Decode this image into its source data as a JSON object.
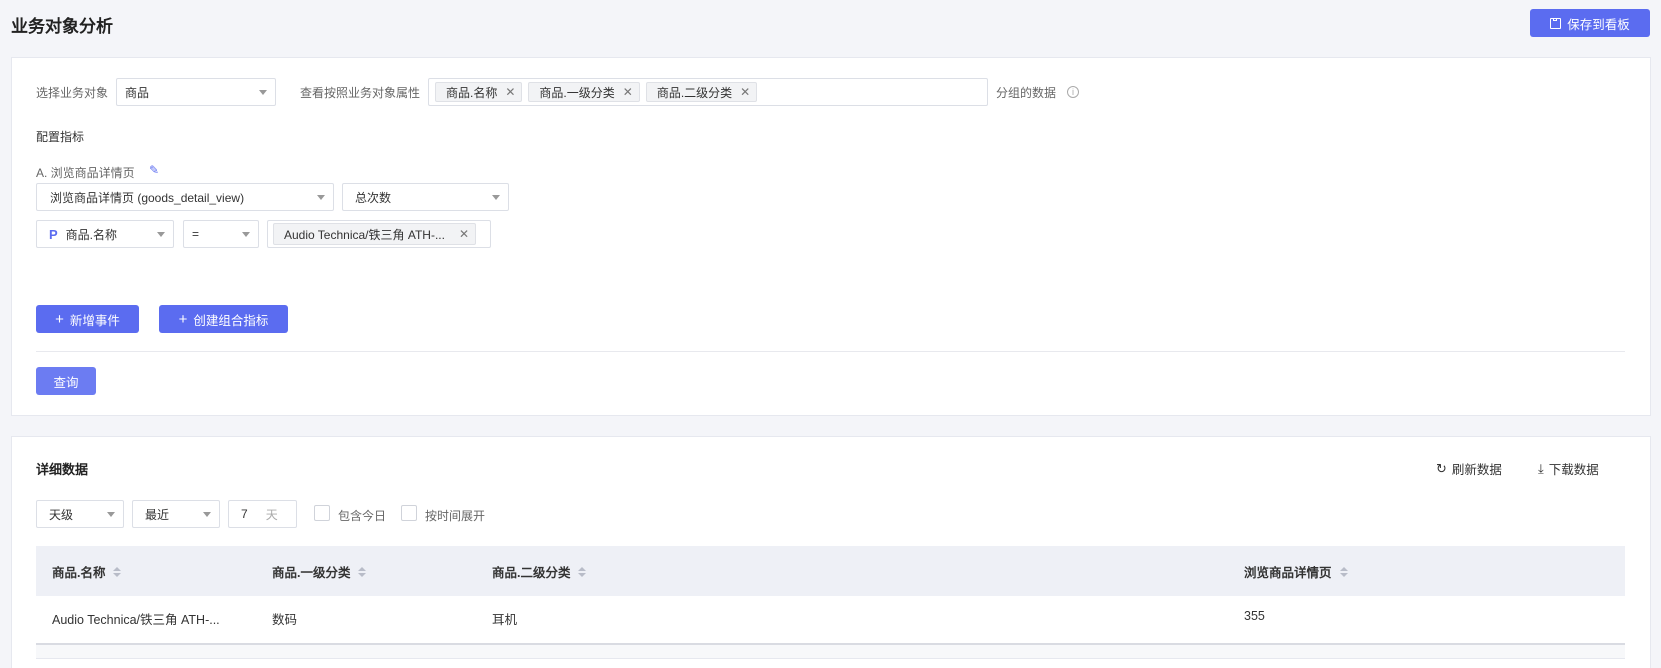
{
  "header": {
    "title": "业务对象分析",
    "save_label": "保存到看板"
  },
  "config": {
    "object_label": "选择业务对象",
    "object_value": "商品",
    "group_by_label": "查看按照业务对象属性",
    "group_by_tags": [
      "商品.名称",
      "商品.一级分类",
      "商品.二级分类"
    ],
    "group_by_suffix": "分组的数据",
    "metrics_label": "配置指标",
    "metric_name": "A. 浏览商品详情页",
    "event_value": "浏览商品详情页 (goods_detail_view)",
    "aggregation_value": "总次数",
    "filter_property": "商品.名称",
    "filter_property_icon": "P",
    "filter_operator": "=",
    "filter_value_tag": "Audio Technica/铁三角 ATH-...",
    "add_event_label": "新增事件",
    "add_combo_label": "创建组合指标",
    "query_label": "查询"
  },
  "details": {
    "title": "详细数据",
    "refresh_label": "刷新数据",
    "download_label": "下载数据",
    "granularity": "天级",
    "range_mode": "最近",
    "range_value": "7",
    "range_unit": "天",
    "include_today_label": "包含今日",
    "expand_by_time_label": "按时间展开",
    "columns": [
      "商品.名称",
      "商品.一级分类",
      "商品.二级分类",
      "浏览商品详情页"
    ],
    "rows": [
      [
        "Audio Technica/铁三角 ATH-...",
        "数码",
        "耳机",
        "355"
      ]
    ]
  },
  "colors": {
    "primary": "#5b6cf0",
    "background": "#f4f5f9"
  }
}
